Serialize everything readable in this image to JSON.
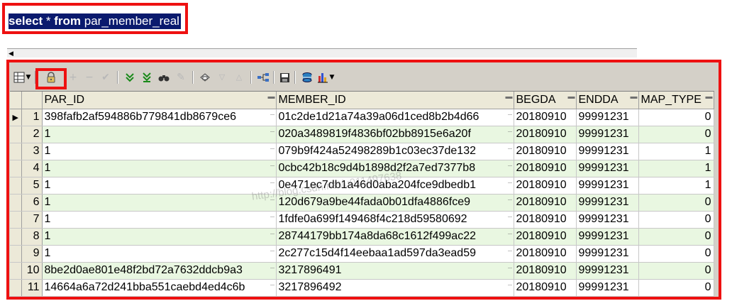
{
  "editor": {
    "sql_keyword_1": "select",
    "sql_rest_1": " * ",
    "sql_keyword_2": "from",
    "sql_rest_2": " par_member_real"
  },
  "toolbar": {
    "icons": [
      "grid-options-icon",
      "lock-icon",
      "plus-icon",
      "minus-icon",
      "check-icon",
      "fetch-next-icon",
      "fetch-last-icon",
      "find-icon",
      "clear-icon",
      "query-by-example-icon",
      "filter-icon",
      "sort-icon",
      "link-icon",
      "save-icon",
      "export-icon",
      "chart-icon"
    ]
  },
  "grid": {
    "columns": [
      "PAR_ID",
      "MEMBER_ID",
      "BEGDA",
      "ENDDA",
      "MAP_TYPE"
    ],
    "rows": [
      {
        "n": "1",
        "par_id": "398fafb2af594886b779841db8679ce6",
        "member_id": "01c2de1d21a74a39a06d1ced8b2b4d66",
        "begda": "20180910",
        "endda": "99991231",
        "map_type": "0"
      },
      {
        "n": "2",
        "par_id": "1",
        "member_id": "020a3489819f4836bf02bb8915e6a20f",
        "begda": "20180910",
        "endda": "99991231",
        "map_type": "0"
      },
      {
        "n": "3",
        "par_id": "1",
        "member_id": "079b9f424a52498289b1c03ec37de132",
        "begda": "20180910",
        "endda": "99991231",
        "map_type": "1"
      },
      {
        "n": "4",
        "par_id": "1",
        "member_id": "0cbc42b18c9d4b1898d2f2a7ed7377b8",
        "begda": "20180910",
        "endda": "99991231",
        "map_type": "1"
      },
      {
        "n": "5",
        "par_id": "1",
        "member_id": "0e471ec7db1a46d0aba204fce9dbedb1",
        "begda": "20180910",
        "endda": "99991231",
        "map_type": "1"
      },
      {
        "n": "6",
        "par_id": "1",
        "member_id": "120d679a9be44fada0b01dfa4886fce9",
        "begda": "20180910",
        "endda": "99991231",
        "map_type": "0"
      },
      {
        "n": "7",
        "par_id": "1",
        "member_id": "1fdfe0a699f149468f4c218d59580692",
        "begda": "20180910",
        "endda": "99991231",
        "map_type": "0"
      },
      {
        "n": "8",
        "par_id": "1",
        "member_id": "28744179bb174a8da68c1612f499ac22",
        "begda": "20180910",
        "endda": "99991231",
        "map_type": "0"
      },
      {
        "n": "9",
        "par_id": "1",
        "member_id": "2c277c15d4f14eebaa1ad597da3ead59",
        "begda": "20180910",
        "endda": "99991231",
        "map_type": "0"
      },
      {
        "n": "10",
        "par_id": "8be2d0ae801e48f2bd72a7632ddcb9a3",
        "member_id": "3217896491",
        "begda": "20180910",
        "endda": "99991231",
        "map_type": "0"
      },
      {
        "n": "11",
        "par_id": "14664a6a72d241bba551caebd4ed4c6b",
        "member_id": "3217896492",
        "begda": "20180910",
        "endda": "99991231",
        "map_type": "0"
      }
    ]
  },
  "watermark": "http://blog.csdn.net/u011497638"
}
